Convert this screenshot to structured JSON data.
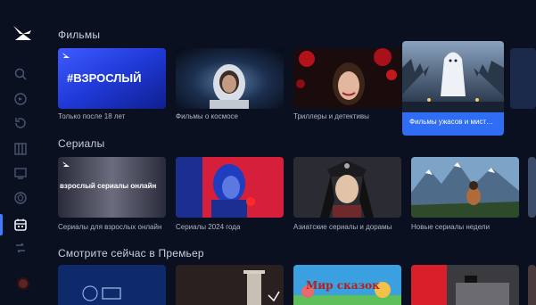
{
  "sections": {
    "movies": {
      "title": "Фильмы",
      "cards": [
        {
          "caption": "Только после 18 лет",
          "poster_text": "#ВЗРОСЛЫЙ"
        },
        {
          "caption": "Фильмы о космосе"
        },
        {
          "caption": "Триллеры и детективы"
        },
        {
          "caption": "Фильмы ужасов и мистика"
        }
      ]
    },
    "series": {
      "title": "Сериалы",
      "cards": [
        {
          "caption": "Сериалы для взрослых онлайн",
          "poster_text": "взрослый сериалы онлайн"
        },
        {
          "caption": "Сериалы 2024 года"
        },
        {
          "caption": "Азиатские сериалы и дорамы"
        },
        {
          "caption": "Новые сериалы недели"
        }
      ]
    },
    "continue": {
      "title": "Смотрите сейчас в Премьер",
      "cards": [
        {
          "caption": ""
        },
        {
          "caption": ""
        },
        {
          "caption": "",
          "poster_text": "Мир сказок"
        },
        {
          "caption": ""
        }
      ]
    }
  },
  "colors": {
    "background": "#0b1020",
    "accent": "#2f6df5",
    "sidebar_icon": "#4b5672",
    "sidebar_icon_active": "#e9eef8"
  },
  "sidebar": {
    "items": [
      {
        "icon": "search-icon"
      },
      {
        "icon": "home-icon"
      },
      {
        "icon": "history-icon"
      },
      {
        "icon": "library-icon"
      },
      {
        "icon": "tv-icon"
      },
      {
        "icon": "sports-icon"
      },
      {
        "icon": "catalog-icon",
        "active": true
      },
      {
        "icon": "settings-icon"
      }
    ]
  }
}
